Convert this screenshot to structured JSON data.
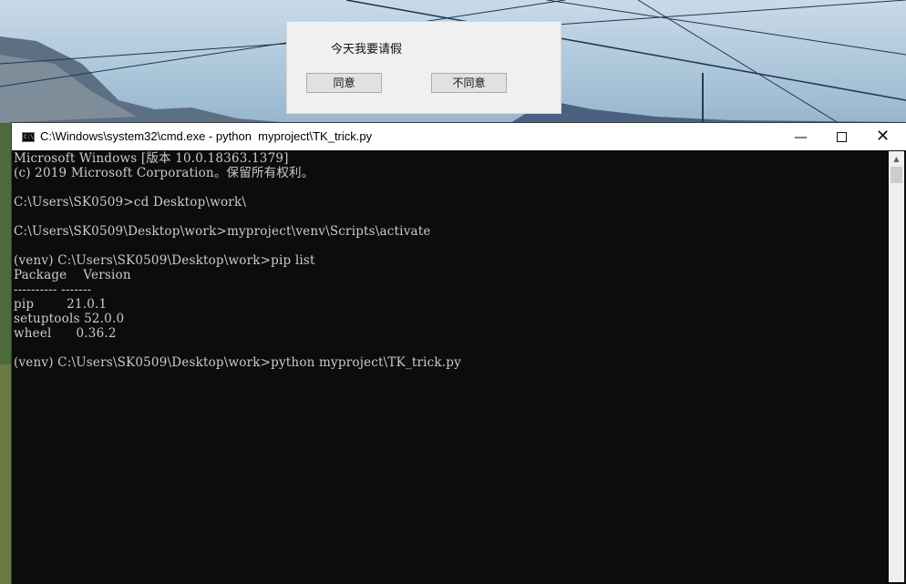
{
  "dialog": {
    "message": "今天我要请假",
    "agree_label": "同意",
    "disagree_label": "不同意"
  },
  "console": {
    "title": "C:\\Windows\\system32\\cmd.exe - python  myproject\\TK_trick.py",
    "icon_text": "C:\\",
    "minimize_glyph": "—",
    "close_glyph": "✕",
    "lines": [
      "Microsoft Windows [版本 10.0.18363.1379]",
      "(c) 2019 Microsoft Corporation。保留所有权利。",
      "",
      "C:\\Users\\SK0509>cd Desktop\\work\\",
      "",
      "C:\\Users\\SK0509\\Desktop\\work>myproject\\venv\\Scripts\\activate",
      "",
      "(venv) C:\\Users\\SK0509\\Desktop\\work>pip list",
      "Package    Version",
      "---------- -------",
      "pip        21.0.1",
      "setuptools 52.0.0",
      "wheel      0.36.2",
      "",
      "(venv) C:\\Users\\SK0509\\Desktop\\work>python myproject\\TK_trick.py"
    ]
  },
  "colors": {
    "console_bg": "#0c0c0c",
    "console_text": "#cccccc",
    "dialog_bg": "#f0f0f0"
  }
}
